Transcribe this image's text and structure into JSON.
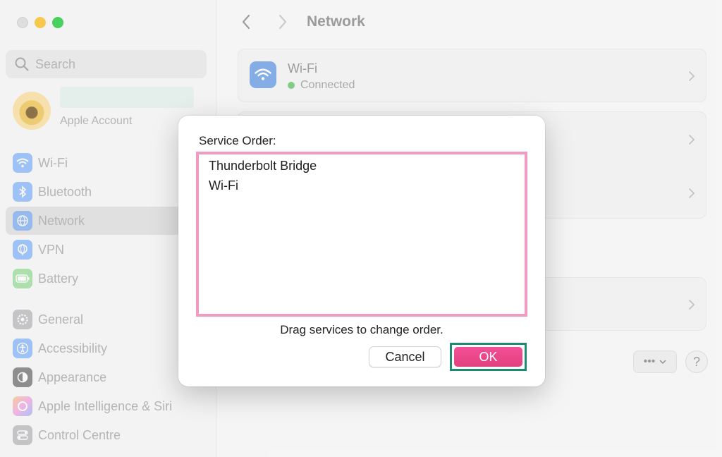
{
  "sidebar": {
    "search_placeholder": "Search",
    "account": {
      "name": "",
      "subtitle": "Apple Account"
    },
    "items": [
      {
        "label": "Wi-Fi",
        "icon": "wifi-icon",
        "color": "#3d8af7"
      },
      {
        "label": "Bluetooth",
        "icon": "bluetooth-icon",
        "color": "#3d8af7"
      },
      {
        "label": "Network",
        "icon": "globe-icon",
        "color": "#3d8af7",
        "selected": true
      },
      {
        "label": "VPN",
        "icon": "vpn-globe-icon",
        "color": "#3d8af7"
      },
      {
        "label": "Battery",
        "icon": "battery-icon",
        "color": "#5ac85a"
      },
      {
        "label": "General",
        "icon": "gear-icon",
        "color": "#8e8e93"
      },
      {
        "label": "Accessibility",
        "icon": "accessibility-icon",
        "color": "#3d8af7"
      },
      {
        "label": "Appearance",
        "icon": "appearance-icon",
        "color": "#1c1c1e"
      },
      {
        "label": "Apple Intelligence & Siri",
        "icon": "siri-icon",
        "color": "#e86bd1"
      },
      {
        "label": "Control Centre",
        "icon": "control-centre-icon",
        "color": "#8e8e93"
      }
    ]
  },
  "main": {
    "title": "Network",
    "wifi_card": {
      "title": "Wi-Fi",
      "status": "Connected",
      "status_color": "#6dc56e"
    }
  },
  "dialog": {
    "heading": "Service Order:",
    "services": [
      "Thunderbolt Bridge",
      "Wi-Fi"
    ],
    "hint": "Drag services to change order.",
    "cancel_label": "Cancel",
    "ok_label": "OK",
    "ok_color": "#ee4a8f",
    "highlight_color": "#f39ac2",
    "ok_frame_color": "#1f8a73"
  }
}
